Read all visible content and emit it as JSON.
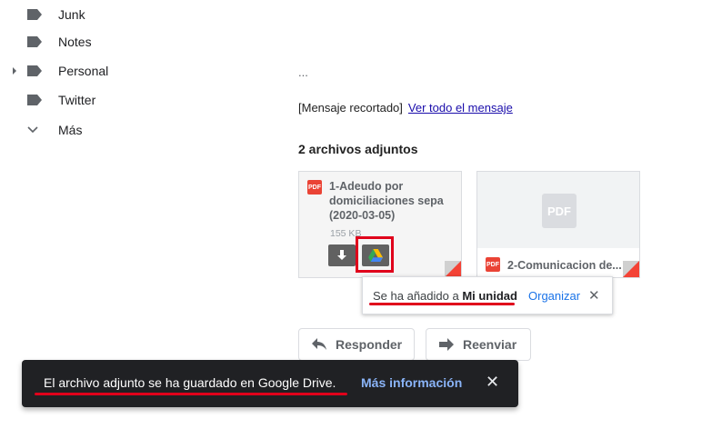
{
  "sidebar": {
    "items": [
      {
        "label": "Junk"
      },
      {
        "label": "Notes"
      },
      {
        "label": "Personal"
      },
      {
        "label": "Twitter"
      }
    ],
    "more_label": "Más"
  },
  "message": {
    "ellipsis": "...",
    "clipped_text": "[Mensaje recortado]",
    "view_all_link": "Ver todo el mensaje",
    "attachments_heading": "2 archivos adjuntos"
  },
  "attachments": [
    {
      "type_badge": "PDF",
      "title_lines": [
        "1-Adeudo por",
        "domiciliaciones sepa",
        "(2020-03-05)"
      ],
      "size": "155 KB"
    },
    {
      "type_badge": "PDF",
      "title": "2-Comunicacion de...",
      "preview_badge": "PDF"
    }
  ],
  "drive_popup": {
    "text_prefix": "Se ha añadido a ",
    "text_bold": "Mi unidad",
    "organize_link": "Organizar",
    "close_glyph": "✕"
  },
  "actions": {
    "reply_label": "Responder",
    "forward_label": "Reenviar"
  },
  "snackbar": {
    "message": "El archivo adjunto se ha guardado en Google Drive.",
    "link": "Más información",
    "close_glyph": "✕"
  },
  "colors": {
    "accent_red": "#e0001b",
    "pdf_red": "#ea4335",
    "link_blue": "#1a73e8",
    "snackbar_bg": "#202124",
    "snackbar_link": "#8ab4f8"
  }
}
